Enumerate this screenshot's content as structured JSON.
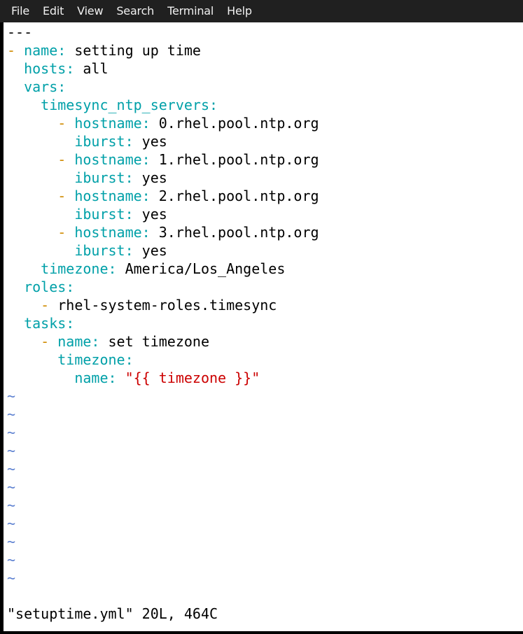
{
  "menu": [
    "File",
    "Edit",
    "View",
    "Search",
    "Terminal",
    "Help"
  ],
  "colors": {
    "key": "#00a0a8",
    "dash": "#d08a00",
    "string": "#cc0000",
    "tilde": "#5b7fd0",
    "text": "#000000",
    "background": "#ffffff"
  },
  "lines": [
    [
      {
        "t": "---",
        "c": "val"
      }
    ],
    [
      {
        "t": "- ",
        "c": "dash"
      },
      {
        "t": "name",
        "c": "key"
      },
      {
        "t": ": ",
        "c": "sep"
      },
      {
        "t": "setting up time",
        "c": "val"
      }
    ],
    [
      {
        "t": "  hosts",
        "c": "key"
      },
      {
        "t": ": ",
        "c": "sep"
      },
      {
        "t": "all",
        "c": "val"
      }
    ],
    [
      {
        "t": "  vars",
        "c": "key"
      },
      {
        "t": ":",
        "c": "sep"
      }
    ],
    [
      {
        "t": "    timesync_ntp_servers",
        "c": "key"
      },
      {
        "t": ":",
        "c": "sep"
      }
    ],
    [
      {
        "t": "      - ",
        "c": "dash"
      },
      {
        "t": "hostname",
        "c": "key"
      },
      {
        "t": ": ",
        "c": "sep"
      },
      {
        "t": "0.rhel.pool.ntp.org",
        "c": "val"
      }
    ],
    [
      {
        "t": "        iburst",
        "c": "key"
      },
      {
        "t": ": ",
        "c": "sep"
      },
      {
        "t": "yes",
        "c": "val"
      }
    ],
    [
      {
        "t": "      - ",
        "c": "dash"
      },
      {
        "t": "hostname",
        "c": "key"
      },
      {
        "t": ": ",
        "c": "sep"
      },
      {
        "t": "1.rhel.pool.ntp.org",
        "c": "val"
      }
    ],
    [
      {
        "t": "        iburst",
        "c": "key"
      },
      {
        "t": ": ",
        "c": "sep"
      },
      {
        "t": "yes",
        "c": "val"
      }
    ],
    [
      {
        "t": "      - ",
        "c": "dash"
      },
      {
        "t": "hostname",
        "c": "key"
      },
      {
        "t": ": ",
        "c": "sep"
      },
      {
        "t": "2.rhel.pool.ntp.org",
        "c": "val"
      }
    ],
    [
      {
        "t": "        iburst",
        "c": "key"
      },
      {
        "t": ": ",
        "c": "sep"
      },
      {
        "t": "yes",
        "c": "val"
      }
    ],
    [
      {
        "t": "      - ",
        "c": "dash"
      },
      {
        "t": "hostname",
        "c": "key"
      },
      {
        "t": ": ",
        "c": "sep"
      },
      {
        "t": "3.rhel.pool.ntp.org",
        "c": "val"
      }
    ],
    [
      {
        "t": "        iburst",
        "c": "key"
      },
      {
        "t": ": ",
        "c": "sep"
      },
      {
        "t": "yes",
        "c": "val"
      }
    ],
    [
      {
        "t": "    timezone",
        "c": "key"
      },
      {
        "t": ": ",
        "c": "sep"
      },
      {
        "t": "America/Los_Angeles",
        "c": "val"
      }
    ],
    [
      {
        "t": "  roles",
        "c": "key"
      },
      {
        "t": ":",
        "c": "sep"
      }
    ],
    [
      {
        "t": "    - ",
        "c": "dash"
      },
      {
        "t": "rhel-system-roles.timesync",
        "c": "val"
      }
    ],
    [
      {
        "t": "  tasks",
        "c": "key"
      },
      {
        "t": ":",
        "c": "sep"
      }
    ],
    [
      {
        "t": "    - ",
        "c": "dash"
      },
      {
        "t": "name",
        "c": "key"
      },
      {
        "t": ": ",
        "c": "sep"
      },
      {
        "t": "set timezone",
        "c": "val"
      }
    ],
    [
      {
        "t": "      timezone",
        "c": "key"
      },
      {
        "t": ":",
        "c": "sep"
      }
    ],
    [
      {
        "t": "        name",
        "c": "key"
      },
      {
        "t": ": ",
        "c": "sep"
      },
      {
        "t": "\"{{ timezone }}\"",
        "c": "str"
      }
    ]
  ],
  "tilde": "~",
  "status": "\"setuptime.yml\" 20L, 464C"
}
